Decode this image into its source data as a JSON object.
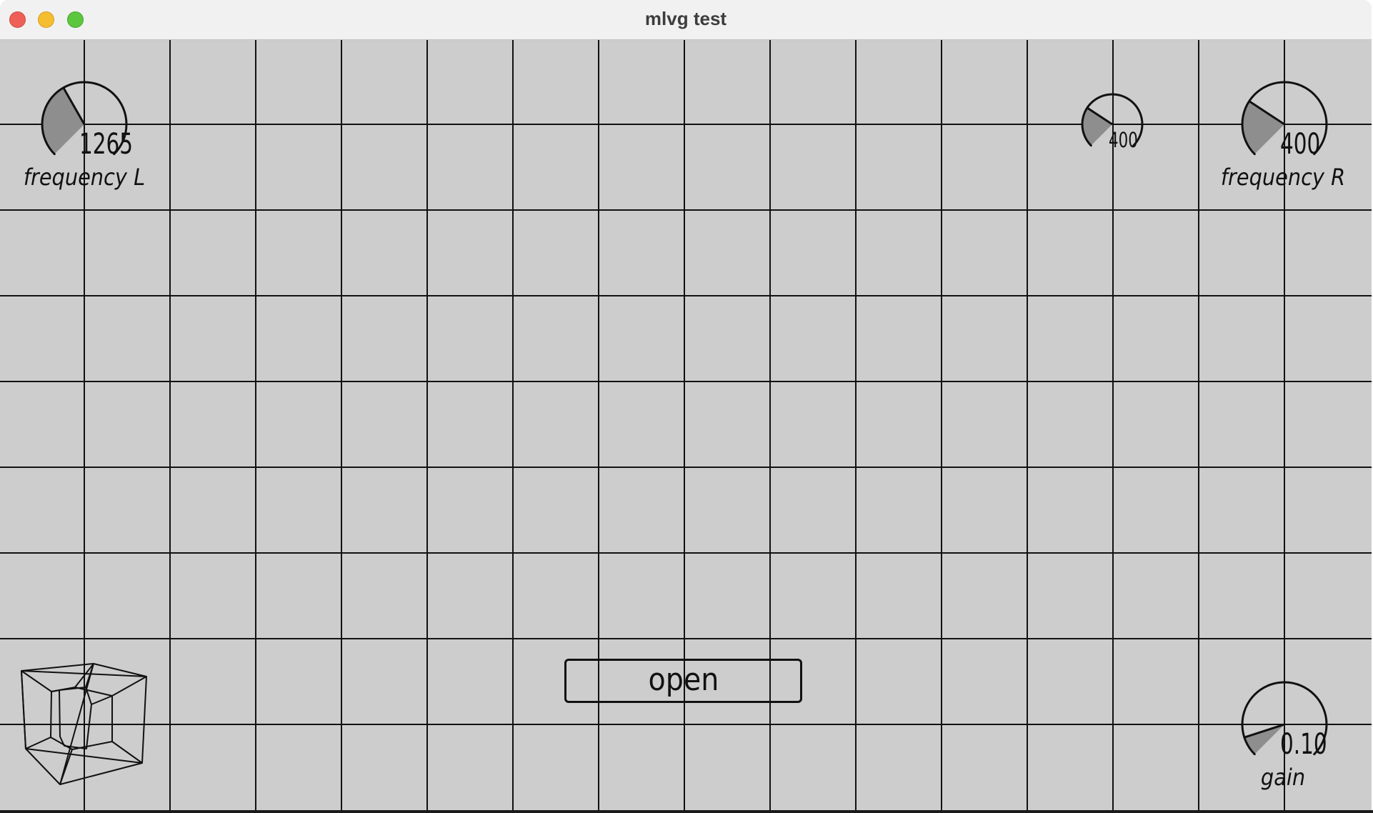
{
  "window": {
    "title": "mlvg test",
    "background": "#cdcdcd"
  },
  "knobs": {
    "frequency_left": {
      "value_text": "1265",
      "label": "frequency L",
      "fill_fraction": 0.39
    },
    "small_dial": {
      "value_text": "400",
      "label": "",
      "fill_fraction": 0.29
    },
    "frequency_right": {
      "value_text": "400",
      "label": "frequency R",
      "fill_fraction": 0.29
    },
    "gain": {
      "value_text": "0.10",
      "label": "gain",
      "fill_fraction": 0.1
    }
  },
  "open_button": {
    "label": "open"
  },
  "colors": {
    "grid_line": "#111111",
    "knob_fill": "#8e8e8e",
    "button_border": "#111111"
  }
}
